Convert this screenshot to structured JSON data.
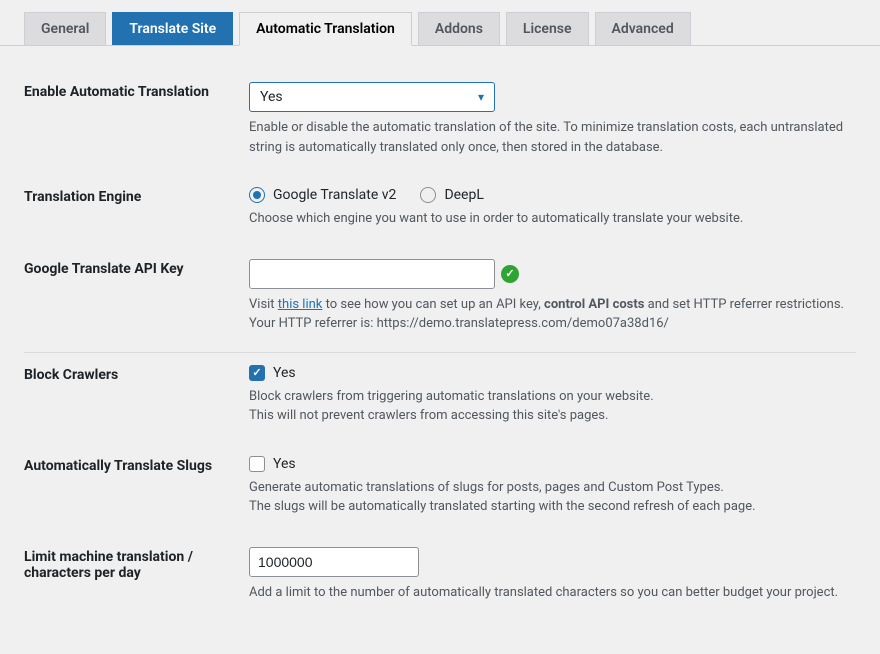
{
  "tabs": [
    {
      "label": "General"
    },
    {
      "label": "Translate Site"
    },
    {
      "label": "Automatic Translation"
    },
    {
      "label": "Addons"
    },
    {
      "label": "License"
    },
    {
      "label": "Advanced"
    }
  ],
  "enable": {
    "label": "Enable Automatic Translation",
    "value": "Yes",
    "desc": "Enable or disable the automatic translation of the site. To minimize translation costs, each untranslated string is automatically translated only once, then stored in the database."
  },
  "engine": {
    "label": "Translation Engine",
    "opt1": "Google Translate v2",
    "opt2": "DeepL",
    "desc": "Choose which engine you want to use in order to automatically translate your website."
  },
  "apikey": {
    "label": "Google Translate API Key",
    "value": "",
    "desc_pre": "Visit ",
    "link_text": "this link",
    "desc_mid": " to see how you can set up an API key, ",
    "bold": "control API costs",
    "desc_post": " and set HTTP referrer restrictions.",
    "referrer": "Your HTTP referrer is: https://demo.translatepress.com/demo07a38d16/"
  },
  "block": {
    "label": "Block Crawlers",
    "checkbox_label": "Yes",
    "desc1": "Block crawlers from triggering automatic translations on your website.",
    "desc2": "This will not prevent crawlers from accessing this site's pages."
  },
  "slugs": {
    "label": "Automatically Translate Slugs",
    "checkbox_label": "Yes",
    "desc1": "Generate automatic translations of slugs for posts, pages and Custom Post Types.",
    "desc2": "The slugs will be automatically translated starting with the second refresh of each page."
  },
  "limit": {
    "label": "Limit machine translation / characters per day",
    "value": "1000000",
    "desc": "Add a limit to the number of automatically translated characters so you can better budget your project."
  }
}
